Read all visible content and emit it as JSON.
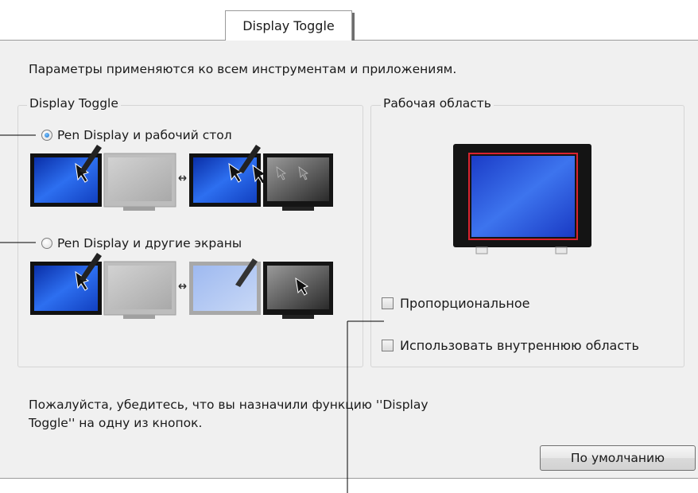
{
  "tab": {
    "label": "Display Toggle"
  },
  "intro_text": "Параметры применяются ко всем инструментам и приложениям.",
  "display_toggle_group": {
    "label": "Display Toggle",
    "options": [
      {
        "label": "Pen Display и рабочий стол",
        "selected": true
      },
      {
        "label": "Pen Display и другие экраны",
        "selected": false
      }
    ]
  },
  "work_area_group": {
    "label": "Рабочая область",
    "checkboxes": [
      {
        "label": "Пропорциональное",
        "checked": false
      },
      {
        "label": "Использовать внутреннюю область",
        "checked": false
      }
    ]
  },
  "note": {
    "line1": "Пожалуйста, убедитесь, что вы назначили функцию ''Display",
    "line2": "Toggle'' на одну из кнопок."
  },
  "default_button": {
    "label": "По умолчанию"
  },
  "colors": {
    "blue_screen": "#1f4fd1",
    "panel_bg": "#f0f0f0",
    "red_border": "#d9232f"
  }
}
